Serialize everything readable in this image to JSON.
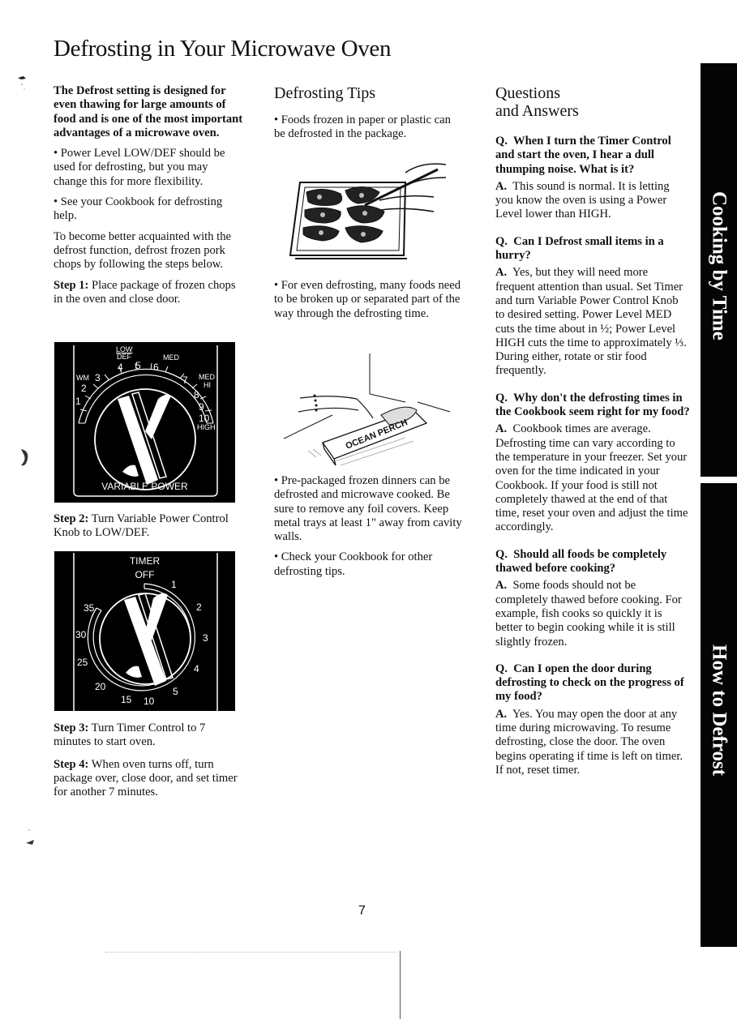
{
  "page": {
    "title": "Defrosting in Your Microwave Oven",
    "page_number": "7"
  },
  "column1": {
    "lead": "The Defrost setting is designed for even thawing for large amounts of food and is one of the most important advantages of a microwave oven.",
    "bullets": [
      "Power Level LOW/DEF should be used for defrosting, but you may change this for more flexibility.",
      "See your Cookbook for defrosting help."
    ],
    "intro": "To become better acquainted with the defrost function, defrost frozen pork chops by following the steps below.",
    "steps": [
      {
        "label": "Step 1:",
        "text": "Place package of frozen chops in the oven and close door."
      },
      {
        "label": "Step 2:",
        "text": "Turn Variable Power Control Knob to LOW/DEF."
      },
      {
        "label": "Step 3:",
        "text": "Turn Timer Control to 7 minutes to start oven."
      },
      {
        "label": "Step 4:",
        "text": "When oven turns off, turn package over, close door, and set timer for another 7 minutes."
      }
    ],
    "power_dial": {
      "caption": "VARIABLE POWER",
      "labels": {
        "low": "LOW",
        "def": "DEF",
        "wm": "WM",
        "med": "MED",
        "med_hi_1": "MED",
        "med_hi_2": "HI",
        "high": "HIGH"
      },
      "numbers": [
        "1",
        "2",
        "3",
        "4",
        "5",
        "6",
        "7",
        "8",
        "9",
        "10"
      ]
    },
    "timer_dial": {
      "caption": "TIMER",
      "off_label": "OFF",
      "numbers": [
        "1",
        "2",
        "3",
        "4",
        "5",
        "10",
        "15",
        "20",
        "25",
        "30",
        "35"
      ]
    }
  },
  "column2": {
    "heading": "Defrosting Tips",
    "tips": [
      "Foods frozen in paper or plastic can be defrosted in the package.",
      "For even defrosting, many foods need to be broken up or separated part of the way through the defrosting time.",
      "Pre-packaged frozen dinners can be defrosted and microwave cooked. Be sure to remove any foil covers. Keep metal trays at least 1\" away from cavity walls.",
      "Check your Cookbook for other defrosting tips."
    ],
    "package_label": "OCEAN PERCH"
  },
  "column3": {
    "heading_line1": "Questions",
    "heading_line2": "and Answers",
    "q_prefix": "Q.",
    "a_prefix": "A.",
    "qa": [
      {
        "q": "When I turn the Timer Control and start the oven, I hear a dull thumping noise. What is it?",
        "a": "This sound is normal. It is letting you know the oven is using a Power Level lower than HIGH."
      },
      {
        "q": "Can I Defrost small items in a hurry?",
        "a": "Yes, but they will need more frequent attention than usual. Set Timer and turn Variable Power Control Knob to desired setting. Power Level MED cuts the time about in ½; Power Level HIGH cuts the time to approximately ⅓. During either, rotate or stir food frequently."
      },
      {
        "q": "Why don't the defrosting times in the Cookbook seem right for my food?",
        "a": "Cookbook times are average. Defrosting time can vary according to the temperature in your freezer. Set your oven for the time indicated in your Cookbook. If your food is still not completely thawed at the end of that time, reset your oven and adjust the time accordingly."
      },
      {
        "q": "Should all foods be completely thawed before cooking?",
        "a": "Some foods should not be completely thawed before cooking. For example, fish cooks so quickly it is better to begin cooking while it is still slightly frozen."
      },
      {
        "q": "Can I open the door during defrosting to check on the progress of my food?",
        "a": "Yes. You may open the door at any time during microwaving. To resume defrosting, close the door. The oven begins operating if time is left on timer. If not, reset timer."
      }
    ]
  },
  "side_tabs": [
    {
      "label": "Cooking by Time"
    },
    {
      "label": "How to Defrost"
    }
  ]
}
